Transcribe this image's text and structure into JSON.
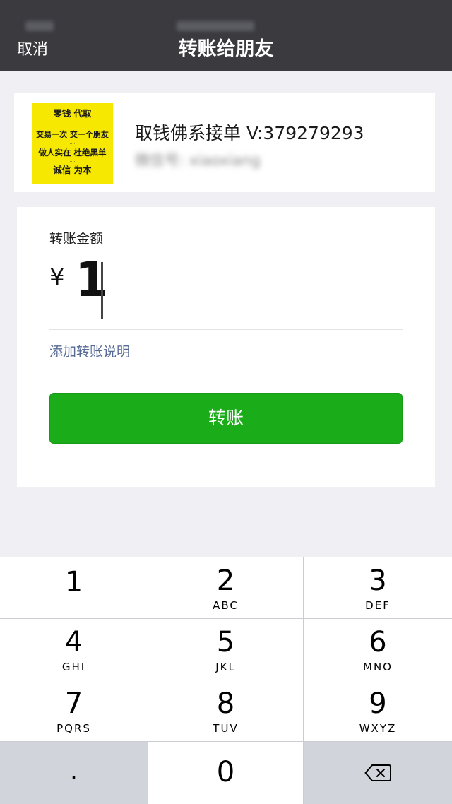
{
  "nav": {
    "cancel_label": "取消",
    "title": "转账给朋友"
  },
  "recipient": {
    "name": "取钱佛系接单 V:379279293",
    "account_blurred": "微信号: xiaoxiang",
    "avatar_text": {
      "line1": "零钱 代取",
      "line2": "交易一次 交一个朋友",
      "line3": "做人实在 杜绝黑单",
      "line4": "诚信 为本"
    }
  },
  "transfer": {
    "amount_label": "转账金额",
    "currency_symbol": "¥",
    "amount_value": "1",
    "add_note_label": "添加转账说明",
    "submit_label": "转账"
  },
  "keypad": {
    "keys": [
      {
        "digit": "1",
        "letters": ""
      },
      {
        "digit": "2",
        "letters": "ABC"
      },
      {
        "digit": "3",
        "letters": "DEF"
      },
      {
        "digit": "4",
        "letters": "GHI"
      },
      {
        "digit": "5",
        "letters": "JKL"
      },
      {
        "digit": "6",
        "letters": "MNO"
      },
      {
        "digit": "7",
        "letters": "PQRS"
      },
      {
        "digit": "8",
        "letters": "TUV"
      },
      {
        "digit": "9",
        "letters": "WXYZ"
      }
    ],
    "dot_label": ".",
    "zero_label": "0",
    "backspace_icon": "backspace-icon"
  },
  "colors": {
    "navbar": "#3a3a3f",
    "primary_button": "#1aad19",
    "link": "#576b95",
    "background": "#efeff4"
  }
}
